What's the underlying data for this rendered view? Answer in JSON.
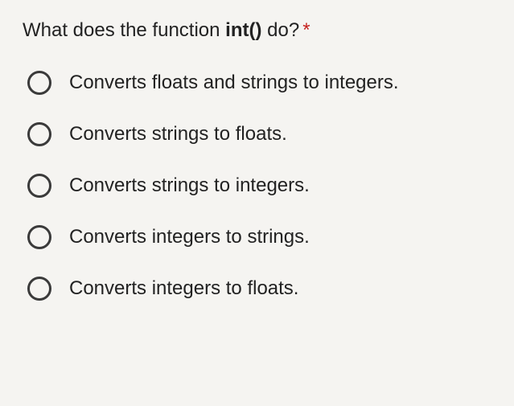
{
  "question": {
    "prefix": "What does the function ",
    "bold": "int()",
    "suffix": " do?",
    "required_marker": "*"
  },
  "options": [
    {
      "label": "Converts floats and strings to integers."
    },
    {
      "label": "Converts strings to floats."
    },
    {
      "label": "Converts strings to integers."
    },
    {
      "label": "Converts integers to strings."
    },
    {
      "label": "Converts integers to floats."
    }
  ]
}
